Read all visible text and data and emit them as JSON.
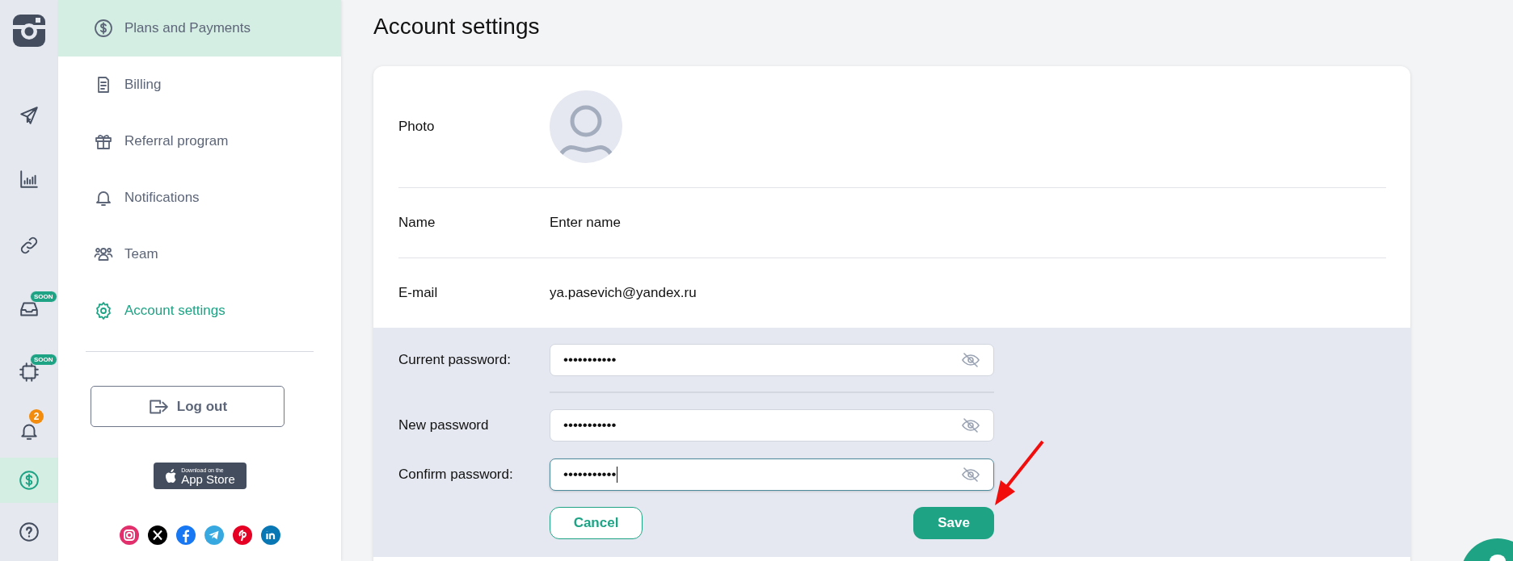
{
  "rail": {
    "items": [
      {
        "selected": false
      },
      {
        "selected": false
      },
      {
        "selected": false
      },
      {
        "selected": false,
        "badge": "SOON"
      },
      {
        "selected": false,
        "badge": "SOON"
      },
      {
        "selected": false,
        "count": "2"
      },
      {
        "selected": true
      },
      {
        "selected": false
      }
    ]
  },
  "menu": {
    "items": [
      {
        "label": "Plans and Payments",
        "hovered": true,
        "selected": false
      },
      {
        "label": "Billing",
        "hovered": false,
        "selected": false
      },
      {
        "label": "Referral program",
        "hovered": false,
        "selected": false
      },
      {
        "label": "Notifications",
        "hovered": false,
        "selected": false
      },
      {
        "label": "Team",
        "hovered": false,
        "selected": false
      },
      {
        "label": "Account settings",
        "hovered": false,
        "selected": true
      }
    ],
    "logout": "Log out",
    "app_store": {
      "small": "Download on the",
      "big": "App Store"
    }
  },
  "page": {
    "title": "Account settings"
  },
  "profile": {
    "photo_label": "Photo",
    "name_label": "Name",
    "name_placeholder": "Enter name",
    "email_label": "E-mail",
    "email": "ya.pasevich@yandex.ru"
  },
  "password": {
    "fields": [
      {
        "label": "Current password:",
        "value": "•••••••••••",
        "focused": false
      },
      {
        "label": "New password",
        "value": "•••••••••••",
        "focused": false
      },
      {
        "label": "Confirm password:",
        "value": "•••••••••••",
        "focused": true
      }
    ],
    "cancel": "Cancel",
    "save": "Save"
  }
}
